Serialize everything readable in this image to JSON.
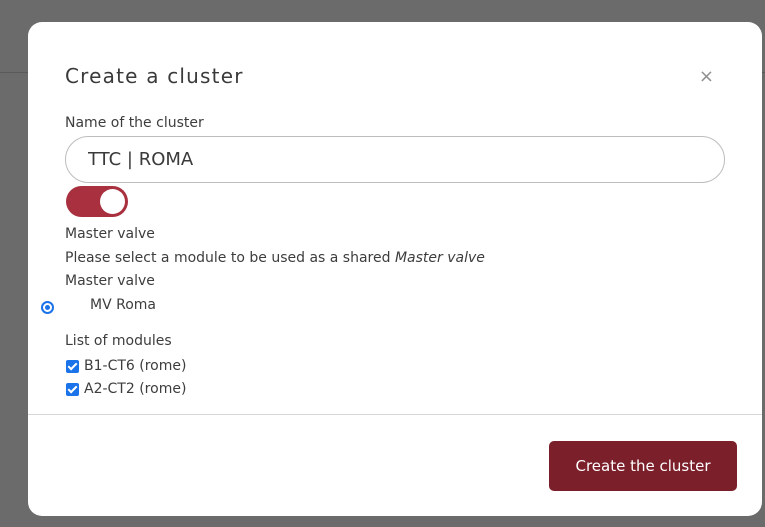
{
  "modal": {
    "title": "Create a cluster",
    "close_glyph": "×",
    "name_label": "Name of the cluster",
    "name_value": "TTC | ROMA",
    "toggle": {
      "state": "on",
      "color": "#a8303f"
    },
    "master_valve_label": "Master valve",
    "instruction_prefix": "Please select a module to be used as a shared ",
    "instruction_emphasis": "Master valve",
    "master_valve_group_label": "Master valve",
    "master_valve_option": "MV Roma",
    "modules_label": "List of modules",
    "modules": [
      {
        "label": "B1-CT6 (rome)",
        "checked": true
      },
      {
        "label": "A2-CT2 (rome)",
        "checked": true
      }
    ],
    "submit_label": "Create the cluster"
  },
  "colors": {
    "accent": "#7b1f2b",
    "toggle": "#a8303f",
    "control_blue": "#1a73e8",
    "overlay": "#6b6b6b"
  },
  "icons": {
    "close": "close-icon",
    "checkbox": "checkmark-icon"
  }
}
